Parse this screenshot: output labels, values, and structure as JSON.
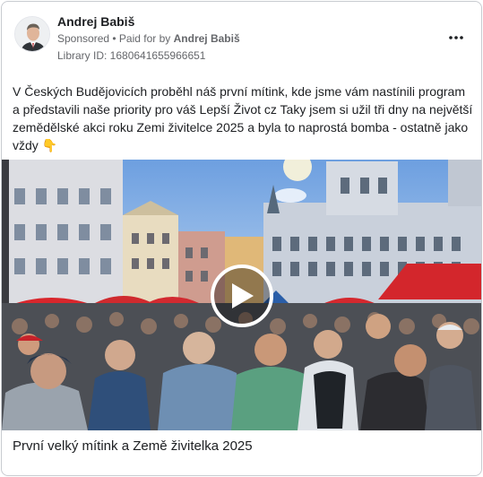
{
  "advertiser": {
    "name": "Andrej Babiš",
    "sponsored_label": "Sponsored",
    "separator": " • ",
    "paid_for_prefix": "Paid for by ",
    "paid_for_name": "Andrej Babiš",
    "library_id": "Library ID: 1680641655966651"
  },
  "post": {
    "text": "V Českých Budějovicích proběhl náš první mítink, kde jsme vám nastínili program a představili naše priority pro váš Lepší Život cz Taky jsem si užil tři dny na největší zemědělské akci roku Zemi živitelce 2025 a byla to naprostá bomba - ostatně jako vždy 👇"
  },
  "media": {
    "type": "video",
    "caption": "První velký mítink a Země živitelka 2025"
  },
  "icons": {
    "more": "more-horizontal-icon",
    "play": "play-icon"
  }
}
